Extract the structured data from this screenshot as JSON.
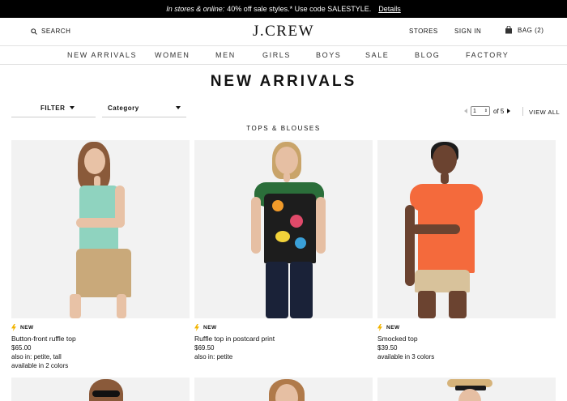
{
  "promo": {
    "lead": "In stores & online:",
    "text": "40% off sale styles.* Use code SALESTYLE.",
    "link": "Details"
  },
  "header": {
    "search_label": "SEARCH",
    "logo": "J.CREW",
    "stores": "STORES",
    "sign_in": "SIGN IN",
    "bag": "BAG (2)"
  },
  "nav": {
    "items": [
      {
        "label": "NEW ARRIVALS"
      },
      {
        "label": "WOMEN"
      },
      {
        "label": "MEN"
      },
      {
        "label": "GIRLS"
      },
      {
        "label": "BOYS"
      },
      {
        "label": "SALE"
      },
      {
        "label": "BLOG"
      },
      {
        "label": "FACTORY"
      }
    ]
  },
  "page_title": "NEW ARRIVALS",
  "filters": {
    "filter_label": "FILTER",
    "category_label": "Category"
  },
  "pager": {
    "current": "1",
    "of": "of 5",
    "view_all": "VIEW ALL"
  },
  "section_title": "TOPS & BLOUSES",
  "products": [
    {
      "badge": "NEW",
      "name": "Button-front ruffle top",
      "price": "$65.00",
      "also_in": "also in: petite, tall",
      "available": "available in 2 colors"
    },
    {
      "badge": "NEW",
      "name": "Ruffle top in postcard print",
      "price": "$69.50",
      "also_in": "also in: petite",
      "available": ""
    },
    {
      "badge": "NEW",
      "name": "Smocked top",
      "price": "$39.50",
      "also_in": "",
      "available": "available in 3 colors"
    }
  ],
  "colors": {
    "promo_bg": "#000000",
    "badge_bolt": "#f2b400",
    "mint_top": "#8fd3bf",
    "orange_top": "#f46a3c"
  }
}
